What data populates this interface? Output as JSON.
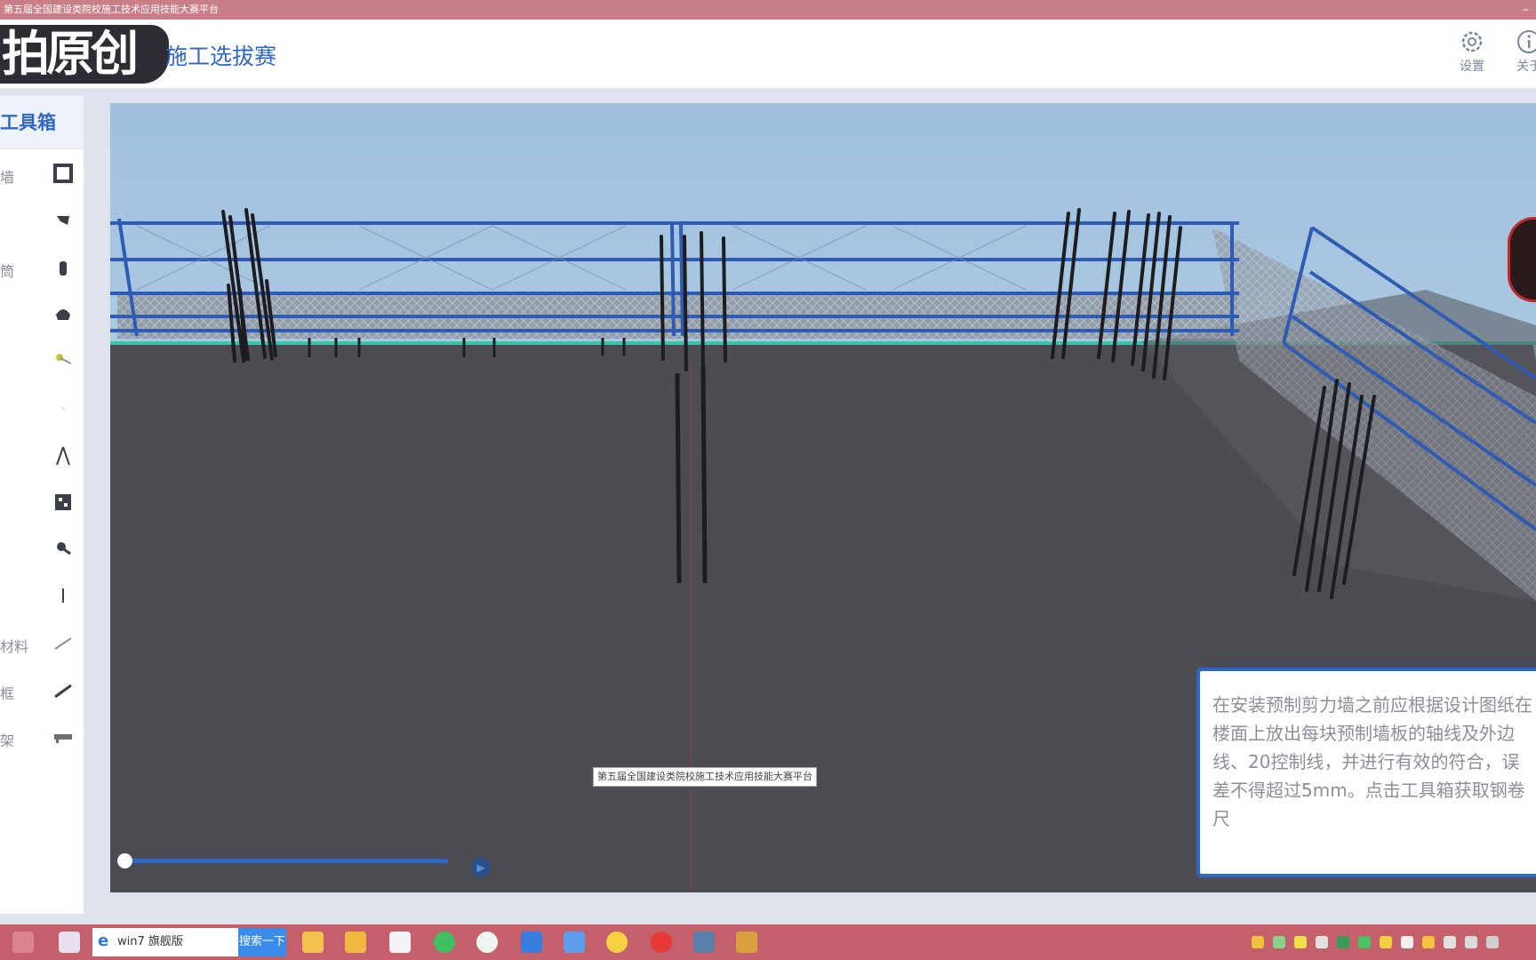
{
  "window": {
    "title": "第五届全国建设类院校施工技术应用技能大赛平台"
  },
  "header": {
    "logo_text": "拍原创",
    "title": "施工选拔赛",
    "settings_label": "设置",
    "about_label": "关于"
  },
  "sidebar": {
    "title": "工具箱",
    "items": [
      {
        "label": "墙",
        "icon": "square-frame-icon"
      },
      {
        "label": "",
        "icon": "tape-icon"
      },
      {
        "label": "筒",
        "icon": "bottle-icon"
      },
      {
        "label": "",
        "icon": "helmet-icon"
      },
      {
        "label": "",
        "icon": "wrench-icon"
      },
      {
        "label": "",
        "icon": "blank-icon"
      },
      {
        "label": "",
        "icon": "compass-icon"
      },
      {
        "label": "",
        "icon": "qr-grid-icon"
      },
      {
        "label": "",
        "icon": "magnifier-icon"
      },
      {
        "label": "",
        "icon": "pin-icon"
      },
      {
        "label": "材料",
        "icon": "line-icon"
      },
      {
        "label": "框",
        "icon": "bar-icon"
      },
      {
        "label": "架",
        "icon": "rail-icon"
      }
    ]
  },
  "scene": {
    "caption": "第五届全国建设类院校施工技术应用技能大赛平台",
    "progress": 0.0
  },
  "prompt": {
    "text": "在安装预制剪力墙之前应根据设计图纸在楼面上放出每块预制墙板的轴线及外边线、20控制线，并进行有效的符合，误差不得超过5mm。点击工具箱获取钢卷尺"
  },
  "taskbar": {
    "search_value": "win7 旗舰版",
    "search_button": "搜索一下"
  },
  "colors": {
    "accent": "#2f67c7",
    "titlebar": "#c97f87",
    "taskbar": "#c4606c"
  }
}
